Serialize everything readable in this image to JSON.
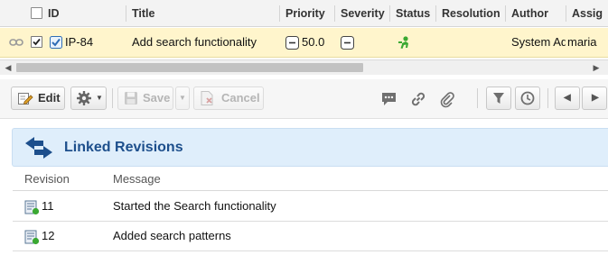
{
  "grid": {
    "columns": [
      "ID",
      "Title",
      "Priority",
      "Severity",
      "Status",
      "Resolution",
      "Author",
      "Assig"
    ],
    "row": {
      "id": "IP-84",
      "title": "Add search functionality",
      "priority": "50.0",
      "author": "System Adı",
      "assignee": "maria"
    }
  },
  "toolbar": {
    "edit_label": "Edit",
    "save_label": "Save",
    "cancel_label": "Cancel"
  },
  "linked_revisions": {
    "title": "Linked Revisions",
    "headers": {
      "revision": "Revision",
      "message": "Message"
    },
    "rows": [
      {
        "revision": "11",
        "message": "Started the Search functionality"
      },
      {
        "revision": "12",
        "message": "Added search patterns"
      }
    ]
  },
  "colors": {
    "row_highlight": "#fff5cc",
    "section_header_bg": "#dfeefb",
    "section_title": "#1d4f8c",
    "status_green": "#3aa832"
  },
  "icons": [
    "link-chain-icon",
    "checkbox-icon",
    "work-item-type-icon",
    "priority-icon",
    "severity-icon",
    "status-icon",
    "edit-icon",
    "gear-icon",
    "save-icon",
    "cancel-icon",
    "comment-icon",
    "link-icon",
    "attachment-icon",
    "filter-icon",
    "history-icon",
    "prev-icon",
    "next-icon",
    "linked-revisions-icon",
    "revision-icon"
  ]
}
